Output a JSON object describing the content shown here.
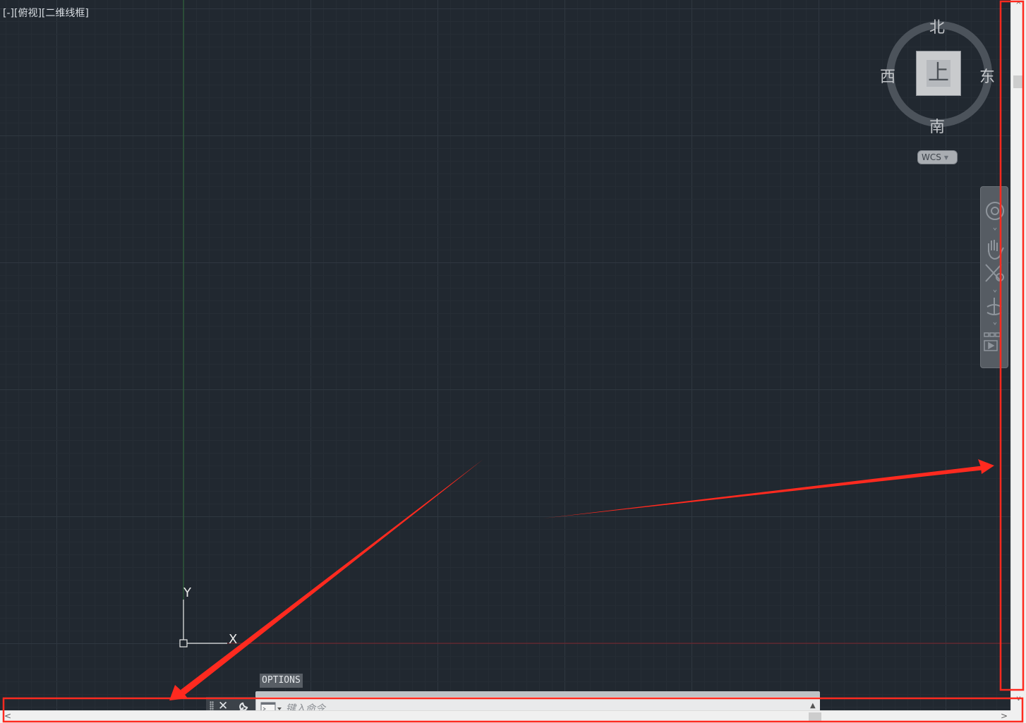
{
  "viewport": {
    "label_prefix": "[-]",
    "label_view": "[俯视]",
    "label_style": "[二维线框]"
  },
  "view_cube": {
    "face": "上",
    "north": "北",
    "south": "南",
    "east": "东",
    "west": "西",
    "wcs_label": "WCS"
  },
  "ucs_icon": {
    "x_label": "X",
    "y_label": "Y"
  },
  "navigation_bar": {
    "tools": [
      "steering-wheel-icon",
      "pan-icon",
      "zoom-extents-icon",
      "orbit-icon",
      "showmotion-icon"
    ]
  },
  "command_line": {
    "options_tooltip": "OPTIONS",
    "placeholder": "键入命令"
  },
  "colors": {
    "canvas_bg": "#212830",
    "grid_minor": "#262d35",
    "grid_major": "#2f3740",
    "y_axis": "#2c6a36",
    "x_axis": "#7a2127",
    "annotation_red": "#ff2a1f"
  }
}
